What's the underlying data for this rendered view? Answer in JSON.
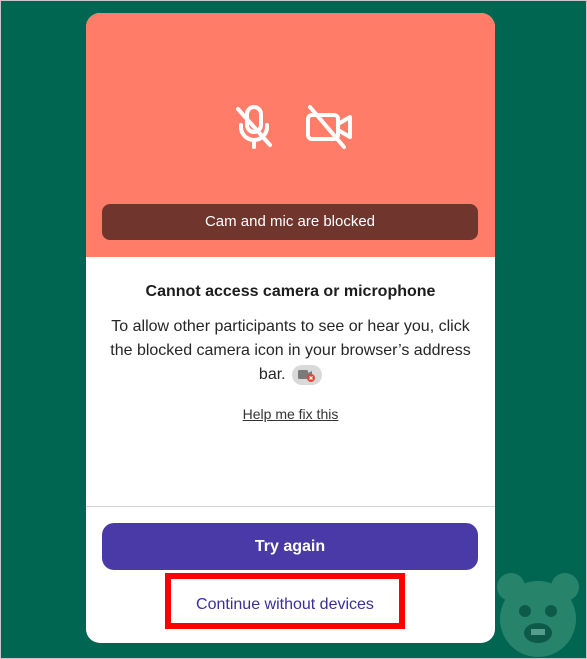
{
  "colors": {
    "page_background": "#006652",
    "preview_background": "#ff7d68",
    "banner_background": "#70352d",
    "primary_button": "#4a3aa8",
    "link_text": "#3a2f99",
    "highlight_border": "#ff0000"
  },
  "preview": {
    "icons": [
      "mic-off-icon",
      "camera-off-icon"
    ],
    "banner_text": "Cam and mic are blocked"
  },
  "message": {
    "title": "Cannot access camera or microphone",
    "description": "To allow other participants to see or hear you, click the blocked camera icon in your browser’s address bar.",
    "help_link": "Help me fix this"
  },
  "actions": {
    "try_again_label": "Try again",
    "continue_label": "Continue without devices"
  }
}
